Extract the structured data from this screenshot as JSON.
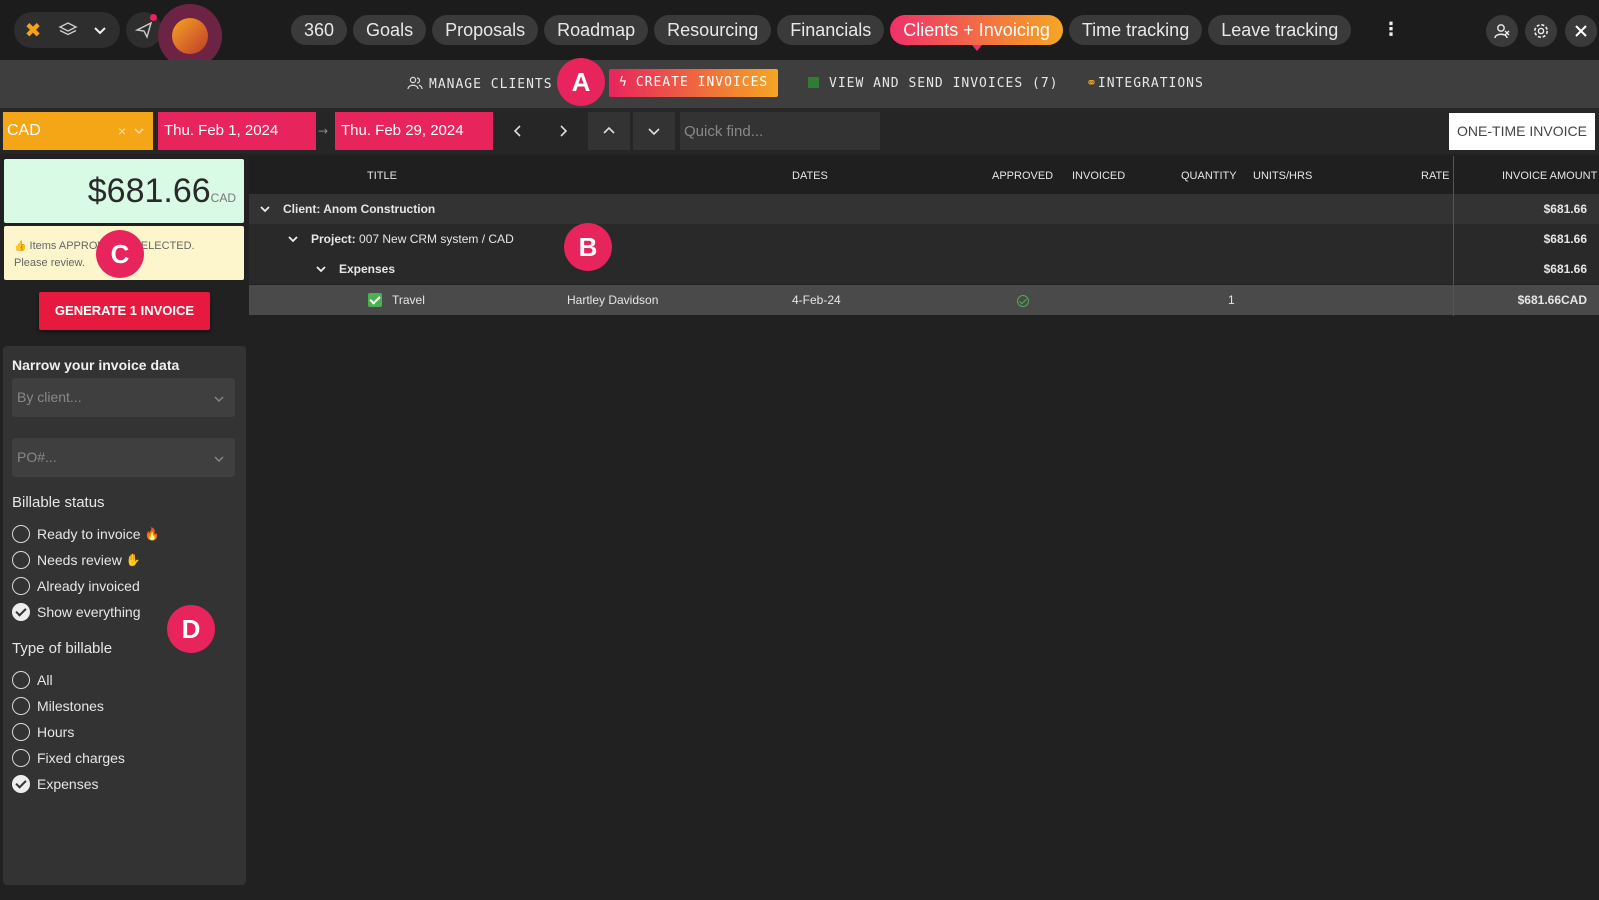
{
  "topnav": {
    "tabs": [
      {
        "label": "360"
      },
      {
        "label": "Goals"
      },
      {
        "label": "Proposals"
      },
      {
        "label": "Roadmap"
      },
      {
        "label": "Resourcing"
      },
      {
        "label": "Financials"
      },
      {
        "label": "Clients + Invoicing",
        "active": true
      },
      {
        "label": "Time tracking"
      },
      {
        "label": "Leave tracking"
      }
    ],
    "more_icon": "kebab-icon",
    "right_icons": [
      "user-switch-icon",
      "gear-icon",
      "close-icon"
    ]
  },
  "subnav": {
    "items": [
      {
        "label": "MANAGE CLIENTS",
        "icon": "users-icon"
      },
      {
        "label": "CREATE INVOICES",
        "icon": "bolt-icon",
        "active": true
      },
      {
        "label": "VIEW AND SEND INVOICES (7)",
        "icon": "green-square-icon"
      },
      {
        "label": "INTEGRATIONS",
        "icon": "link-icon"
      }
    ]
  },
  "markers": {
    "a": "A",
    "b": "B",
    "c": "C",
    "d": "D"
  },
  "filters": {
    "currency": "CAD",
    "clear_symbol": "×",
    "date_from": "Thu. Feb 1, 2024",
    "date_arrow": "→",
    "date_to": "Thu. Feb 29, 2024",
    "quick_find_placeholder": "Quick find...",
    "one_time_invoice": "ONE-TIME INVOICE"
  },
  "summary": {
    "total": "$681.66",
    "currency": "CAD",
    "warning_icon": "👍",
    "warning_line1": "Items APPROVED & SELECTED.",
    "warning_line2": "Please review.",
    "generate_button": "GENERATE 1 INVOICE"
  },
  "narrow": {
    "title": "Narrow your invoice data",
    "client_placeholder": "By client...",
    "po_placeholder": "PO#...",
    "billable_status_label": "Billable status",
    "billable_status": [
      {
        "label": "Ready to invoice",
        "emoji": "🔥",
        "checked": false
      },
      {
        "label": "Needs review",
        "emoji": "✋",
        "checked": false
      },
      {
        "label": "Already invoiced",
        "emoji": "",
        "checked": false
      },
      {
        "label": "Show everything",
        "emoji": "",
        "checked": true
      }
    ],
    "type_label": "Type of billable",
    "types": [
      {
        "label": "All",
        "checked": false
      },
      {
        "label": "Milestones",
        "checked": false
      },
      {
        "label": "Hours",
        "checked": false
      },
      {
        "label": "Fixed charges",
        "checked": false
      },
      {
        "label": "Expenses",
        "checked": true
      }
    ]
  },
  "table": {
    "headers": {
      "title": "TITLE",
      "dates": "DATES",
      "approved": "APPROVED",
      "invoiced": "INVOICED",
      "quantity": "QUANTITY",
      "units": "UNITS/HRS",
      "rate": "RATE",
      "amount": "INVOICE AMOUNT"
    },
    "client_row": {
      "prefix": "Client:",
      "name": "Anom Construction",
      "amount": "$681.66"
    },
    "project_row": {
      "prefix": "Project:",
      "name": "007 New CRM system / CAD",
      "amount": "$681.66"
    },
    "group_row": {
      "name": "Expenses",
      "amount": "$681.66"
    },
    "item_row": {
      "title": "Travel",
      "person": "Hartley Davidson",
      "date": "4-Feb-24",
      "approved": true,
      "quantity": "1",
      "amount": "$681.66CAD"
    }
  }
}
